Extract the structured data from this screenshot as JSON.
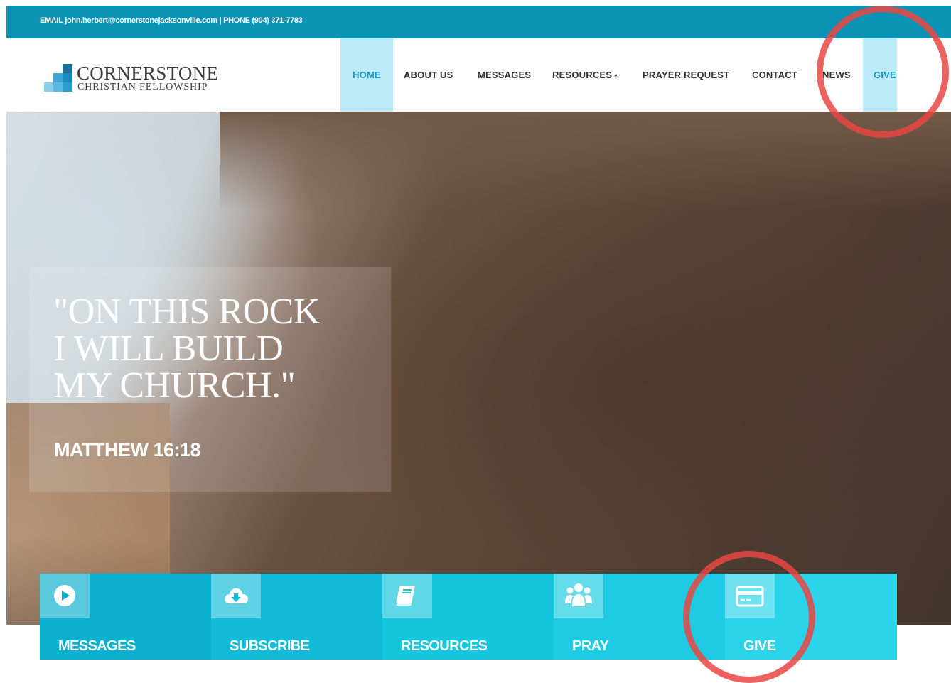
{
  "topbar": {
    "contact_line": "EMAIL john.herbert@cornerstonejacksonville.com | PHONE (904) 371-7783"
  },
  "logo": {
    "title": "CORNERSTONE",
    "subtitle": "CHRISTIAN FELLOWSHIP"
  },
  "nav": {
    "home": "HOME",
    "about": "ABOUT US",
    "messages": "MESSAGES",
    "resources": "RESOURCES",
    "resources_caret": "»",
    "prayer": "PRAYER REQUEST",
    "contact": "CONTACT",
    "news": "NEWS",
    "give": "GIVE"
  },
  "hero": {
    "quote_line1": "\"ON THIS ROCK",
    "quote_line2": "I WILL BUILD",
    "quote_line3": "MY CHURCH.\"",
    "reference": "MATTHEW 16:18"
  },
  "tiles": {
    "messages": "MESSAGES",
    "subscribe": "SUBSCRIBE",
    "resources": "RESOURCES",
    "pray": "PRAY",
    "give": "GIVE"
  },
  "colors": {
    "topbar": "#0a93b5",
    "nav_highlight": "#bceaf8",
    "nav_highlight_text": "#1a99c4",
    "tile_1": "#0cb0cf",
    "tile_2": "#12bcd8",
    "tile_3": "#16c5de",
    "tile_4": "#1dcce4",
    "tile_5": "#2bd4ea",
    "annotation_circle": "#e84642"
  },
  "icons": {
    "messages": "play-circle-icon",
    "subscribe": "cloud-download-icon",
    "resources": "book-icon",
    "pray": "people-group-icon",
    "give": "credit-card-icon"
  }
}
